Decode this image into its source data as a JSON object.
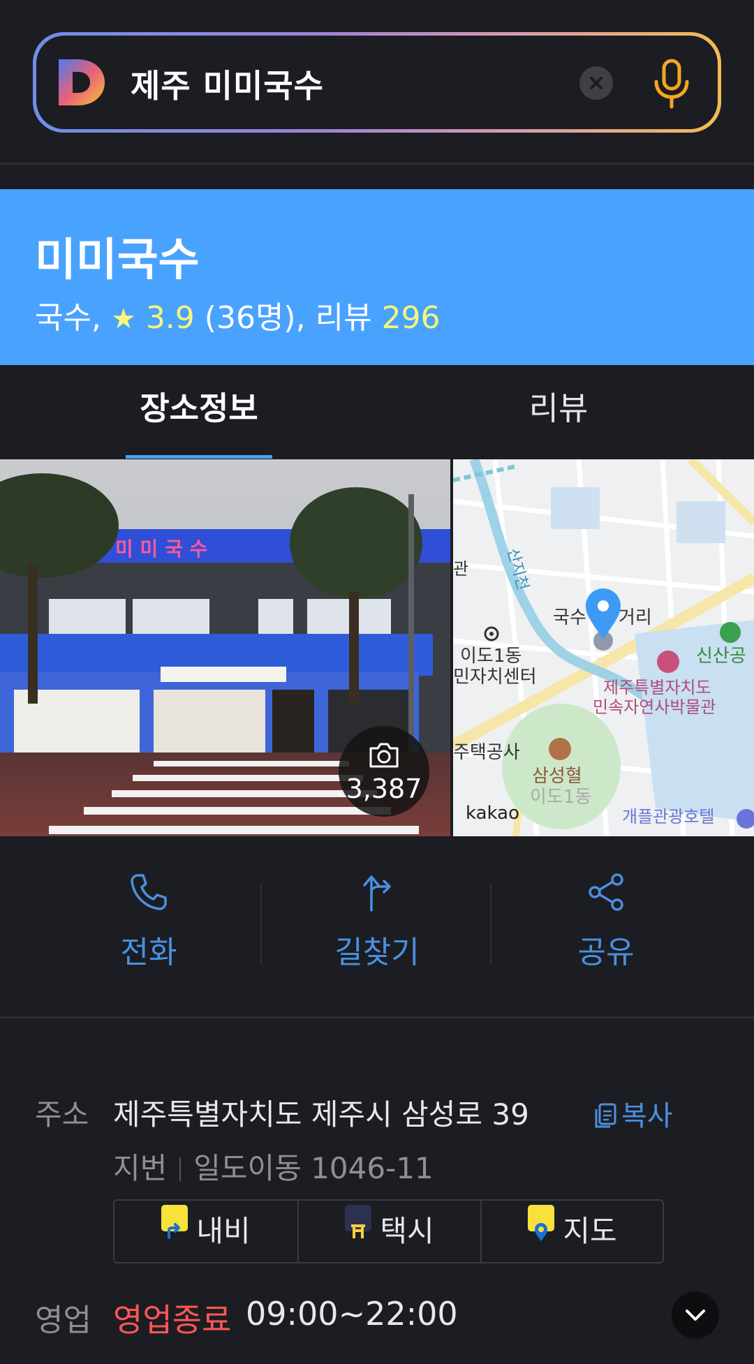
{
  "search": {
    "query": "제주 미미국수",
    "logo": "D",
    "clear_icon": "close-icon",
    "mic_icon": "microphone-icon"
  },
  "place": {
    "name": "미미국수",
    "category": "국수,",
    "rating": "3.9",
    "rating_count": "(36명),",
    "review_label": "리뷰",
    "review_count": "296"
  },
  "tabs": [
    {
      "label": "장소정보",
      "active": true
    },
    {
      "label": "리뷰",
      "active": false
    }
  ],
  "photo": {
    "count": "3,387",
    "sign_text": "미 미 국 수"
  },
  "map": {
    "attribution": "kakao",
    "labels": {
      "l1": "국수",
      "l2": "거리",
      "l3": "신산공",
      "l4": "이도1동",
      "l5": "민자치센터",
      "l6": "제주특별자치도",
      "l7": "민속자연사박물관",
      "l8": "주택공사",
      "l9": "삼성혈",
      "l10": "이도1동",
      "l11": "개플관광호텔",
      "l12": "산지천",
      "l13": "관"
    }
  },
  "actions": [
    {
      "label": "전화",
      "icon": "phone-icon"
    },
    {
      "label": "길찾기",
      "icon": "directions-icon"
    },
    {
      "label": "공유",
      "icon": "share-icon"
    }
  ],
  "address": {
    "label": "주소",
    "road": "제주특별자치도 제주시 삼성로 39",
    "copy_label": "복사",
    "lot_label": "지번",
    "lot": "일도이동 1046-11",
    "buttons": [
      {
        "label": "내비"
      },
      {
        "label": "택시"
      },
      {
        "label": "지도"
      }
    ]
  },
  "hours": {
    "label": "영업",
    "status": "영업종료",
    "time": "09:00~22:00"
  },
  "colors": {
    "header_blue": "#4aa2ff",
    "accent_blue": "#4a90e2",
    "status_red": "#ff5656",
    "rating_yellow": "#f7f77a"
  }
}
